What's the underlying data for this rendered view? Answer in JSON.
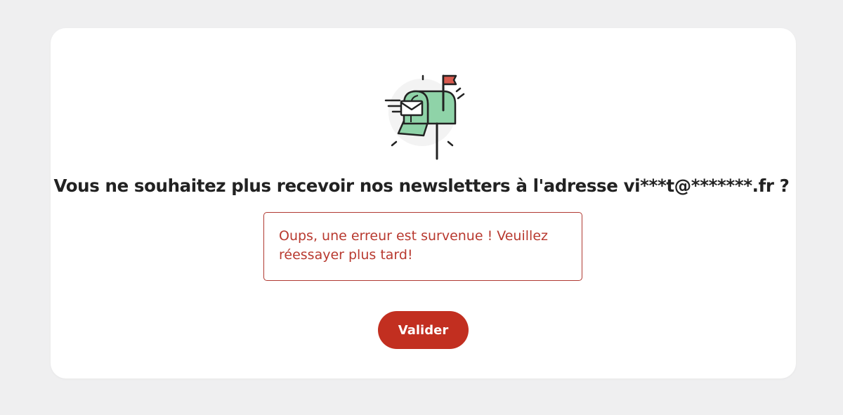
{
  "dialog": {
    "title": "Vous ne souhaitez plus recevoir nos newsletters à l'adresse vi***t@*******.fr ?",
    "illustration_icon": "mailbox-icon",
    "error_message": "Oups, une erreur est survenue ! Veuillez réessayer plus tard!",
    "submit_label": "Valider"
  },
  "colors": {
    "page_background": "#efeff0",
    "card_background": "#ffffff",
    "error": "#b8392f",
    "button": "#c22f20",
    "mailbox_green": "#8fd3a8",
    "flag_red": "#d85a4f"
  }
}
